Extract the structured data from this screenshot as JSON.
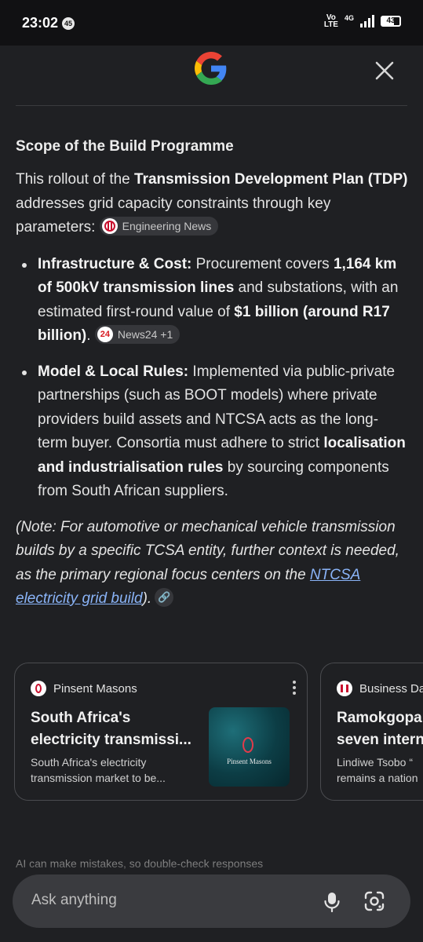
{
  "status": {
    "time": "23:02",
    "notif_count": "45",
    "volte": "Vo\nLTE",
    "network": "4G",
    "battery": "43"
  },
  "header": {
    "logo": "google-g-logo",
    "close": "close-icon"
  },
  "answer": {
    "heading": "Scope of the Build Programme",
    "intro": {
      "t1": "This rollout of the ",
      "b1": "Transmission Development Plan (TDP)",
      "t2": " addresses grid capacity constraints through key parameters:",
      "source_chip": "Engineering News"
    },
    "bullets": [
      {
        "label": "Infrastructure & Cost:",
        "t1": " Procurement covers ",
        "b1": "1,164 km of 500kV transmission lines",
        "t2": " and substations, with an estimated first-round value of ",
        "b2": "$1 billion (around R17 billion)",
        "t3": ".",
        "source_chip": "News24 +1"
      },
      {
        "label": "Model & Local Rules:",
        "t1": " Implemented via public-private partnerships (such as BOOT models) where private providers build assets and NTCSA acts as the long-term buyer. Consortia must adhere to strict ",
        "b1": "localisation and industrialisation rules",
        "t2": " by sourcing components from South African suppliers."
      }
    ],
    "note": {
      "t1": "(Note: For automotive or mechanical vehicle transmission builds by a specific TCSA entity, further context is needed, as the primary regional focus centers on the ",
      "link": "NTCSA electricity grid build",
      "t2": ")."
    }
  },
  "cards": [
    {
      "source": "Pinsent Masons",
      "title_l1": "South Africa's",
      "title_l2": "electricity transmissi...",
      "snippet_l1": "South Africa's electricity",
      "snippet_l2": "transmission market to be...",
      "thumb_text": "Pinsent Masons"
    },
    {
      "source": "Business Da",
      "title_l1": "Ramokgopa",
      "title_l2": "seven intern",
      "snippet_l1": "Lindiwe Tsobo “",
      "snippet_l2": "remains a nation"
    }
  ],
  "disclaimer": "AI can make mistakes, so double-check responses",
  "ask": {
    "placeholder": "Ask anything"
  },
  "colors": {
    "background": "#1f2023",
    "link": "#8ab4f8",
    "chip": "#36373b"
  }
}
